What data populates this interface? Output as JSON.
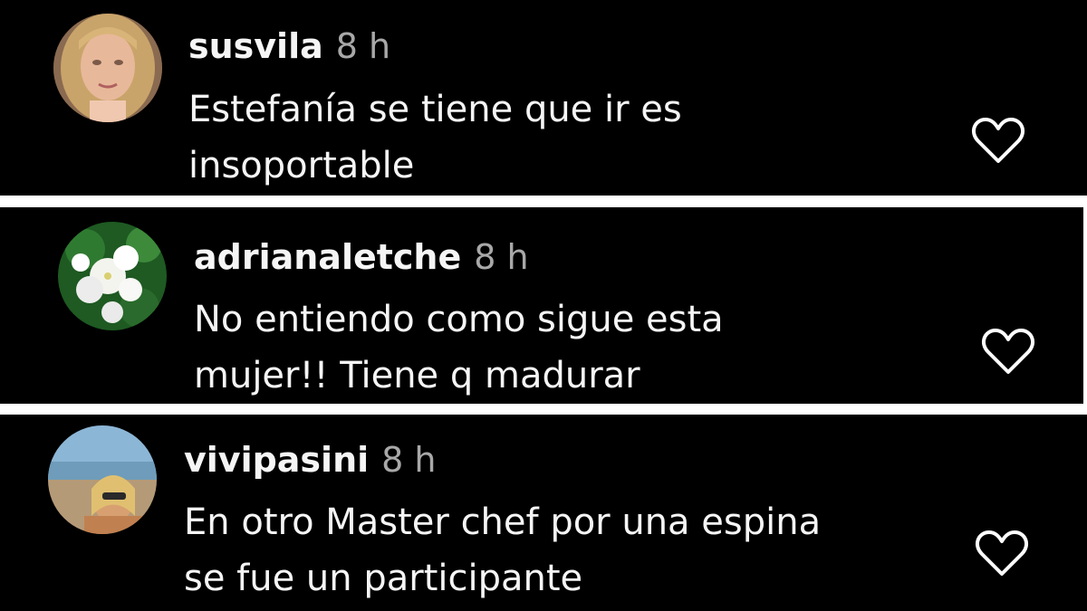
{
  "comments": [
    {
      "username": "susvila",
      "time": "8 h",
      "lines": [
        "Estefanía se tiene que ir es",
        "insoportable"
      ],
      "avatar": "blonde-woman-portrait",
      "like_icon": "heart-outline-icon"
    },
    {
      "username": "adrianaletche",
      "time": "8 h",
      "lines": [
        "No entiendo como sigue esta",
        "mujer!! Tiene q madurar"
      ],
      "avatar": "white-flowers-photo",
      "like_icon": "heart-outline-icon"
    },
    {
      "username": "vivipasini",
      "time": "8 h",
      "lines": [
        "En otro Master chef por una espina",
        "se fue un participante"
      ],
      "avatar": "beach-selfie-photo",
      "like_icon": "heart-outline-icon"
    }
  ],
  "colors": {
    "background": "#000000",
    "separator": "#ffffff",
    "username": "#f5f5f5",
    "timestamp": "#a8a8a8",
    "text": "#f5f5f5",
    "icon": "#ffffff"
  }
}
